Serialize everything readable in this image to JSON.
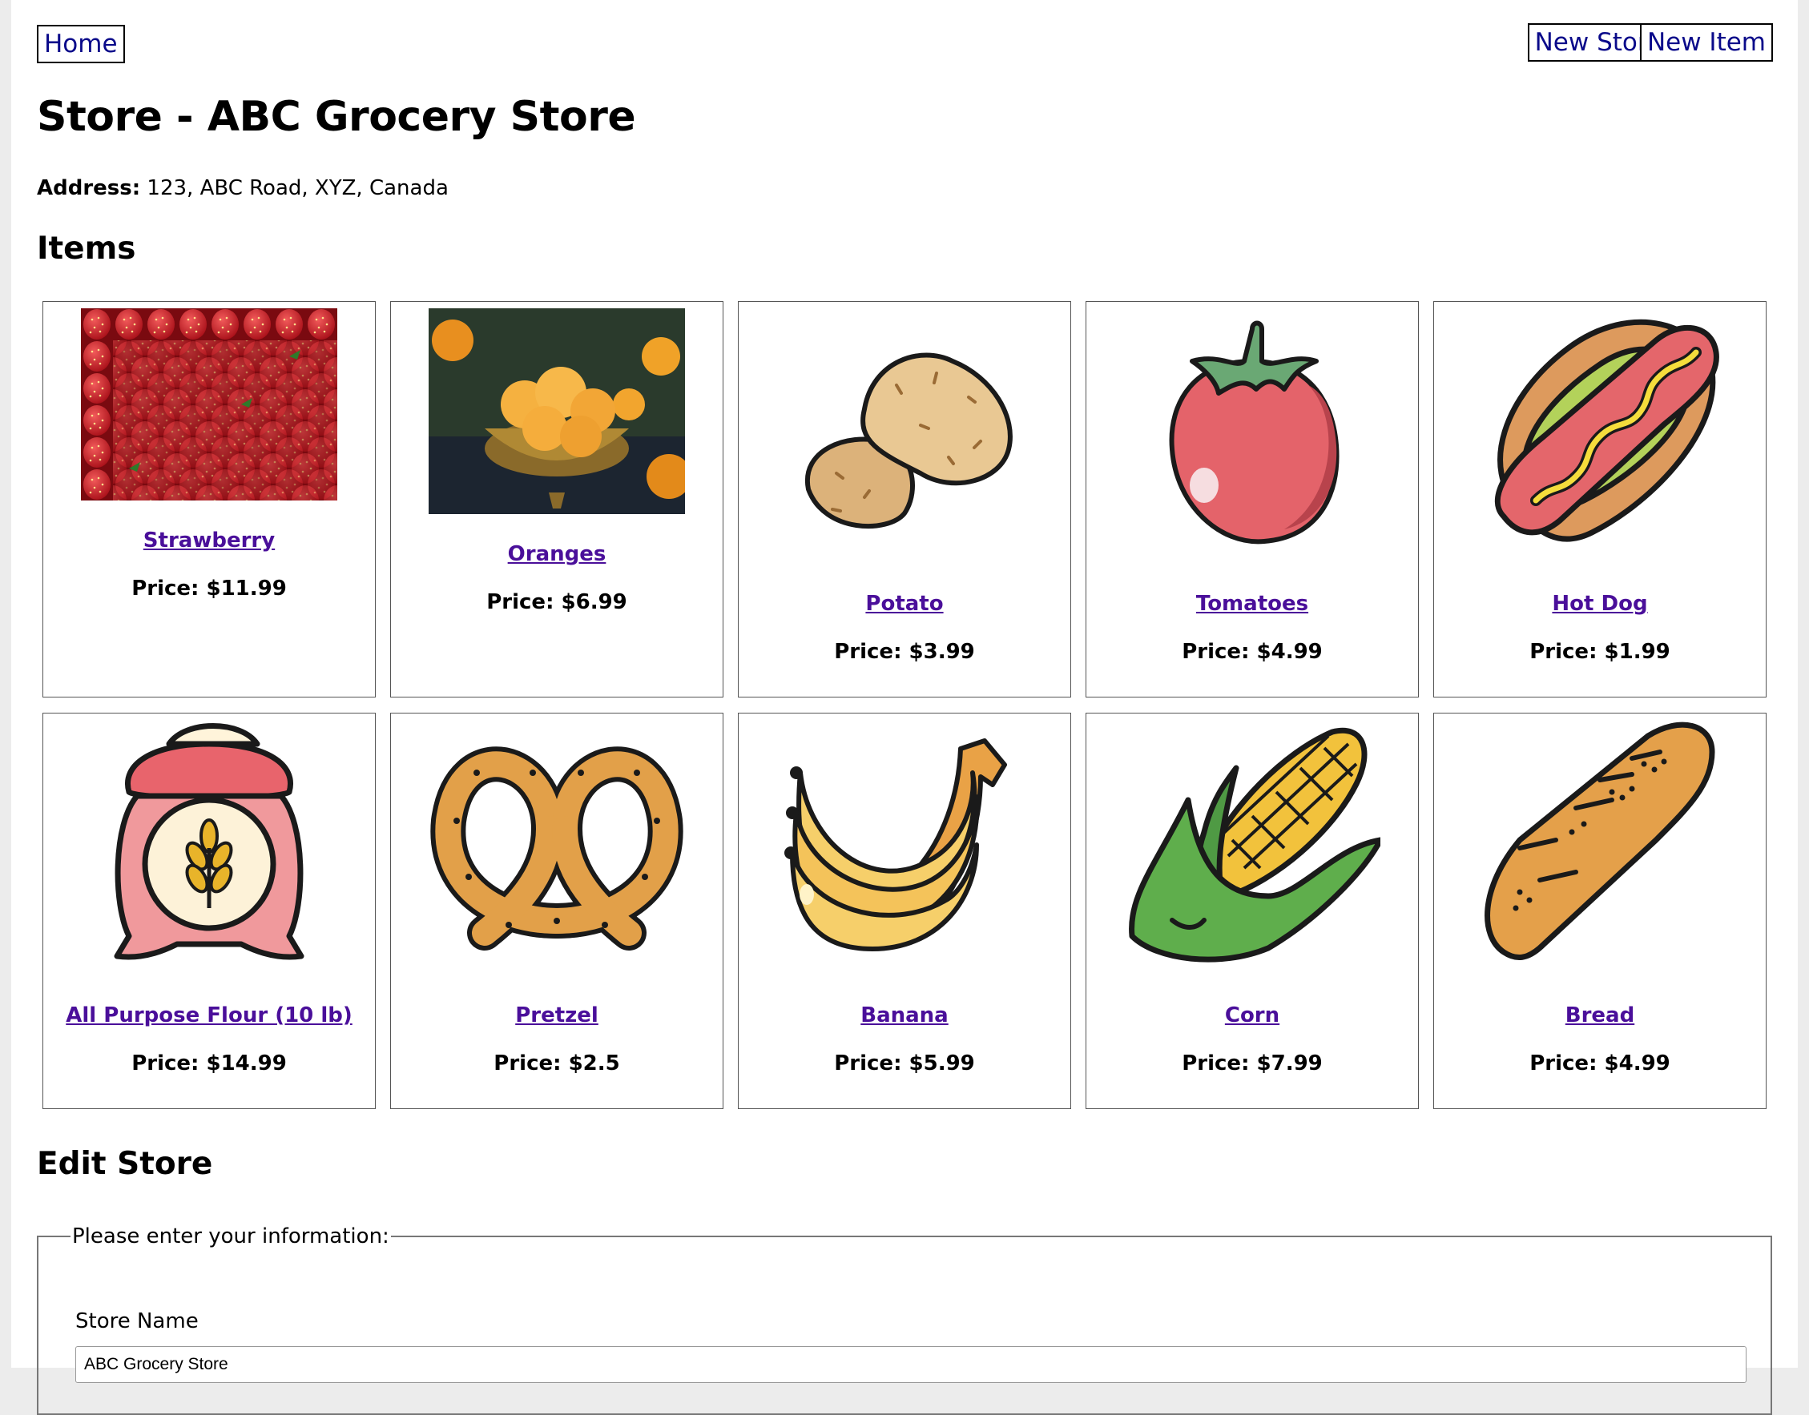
{
  "nav": {
    "home_label": "Home",
    "new_store_label": "New Store",
    "new_item_label": "New Item"
  },
  "page": {
    "title": "Store - ABC Grocery Store",
    "address_label": "Address:",
    "address_value": " 123, ABC Road, XYZ, Canada",
    "items_heading": "Items",
    "edit_heading": "Edit Store"
  },
  "items": [
    {
      "name": "Strawberry",
      "price": "Price: $11.99",
      "icon": "strawberry-photo"
    },
    {
      "name": "Oranges",
      "price": "Price: $6.99",
      "icon": "oranges-photo"
    },
    {
      "name": "Potato",
      "price": "Price: $3.99",
      "icon": "potato-icon"
    },
    {
      "name": "Tomatoes",
      "price": "Price: $4.99",
      "icon": "tomato-icon"
    },
    {
      "name": "Hot Dog",
      "price": "Price: $1.99",
      "icon": "hot-dog-icon"
    },
    {
      "name": "All Purpose Flour (10 lb)",
      "price": "Price: $14.99",
      "icon": "flour-sack-icon"
    },
    {
      "name": "Pretzel",
      "price": "Price: $2.5",
      "icon": "pretzel-icon"
    },
    {
      "name": "Banana",
      "price": "Price: $5.99",
      "icon": "banana-icon"
    },
    {
      "name": "Corn",
      "price": "Price: $7.99",
      "icon": "corn-icon"
    },
    {
      "name": "Bread",
      "price": "Price: $4.99",
      "icon": "bread-icon"
    }
  ],
  "form": {
    "legend": "Please enter your information:",
    "store_name_label": "Store Name",
    "store_name_value": "ABC Grocery Store"
  }
}
